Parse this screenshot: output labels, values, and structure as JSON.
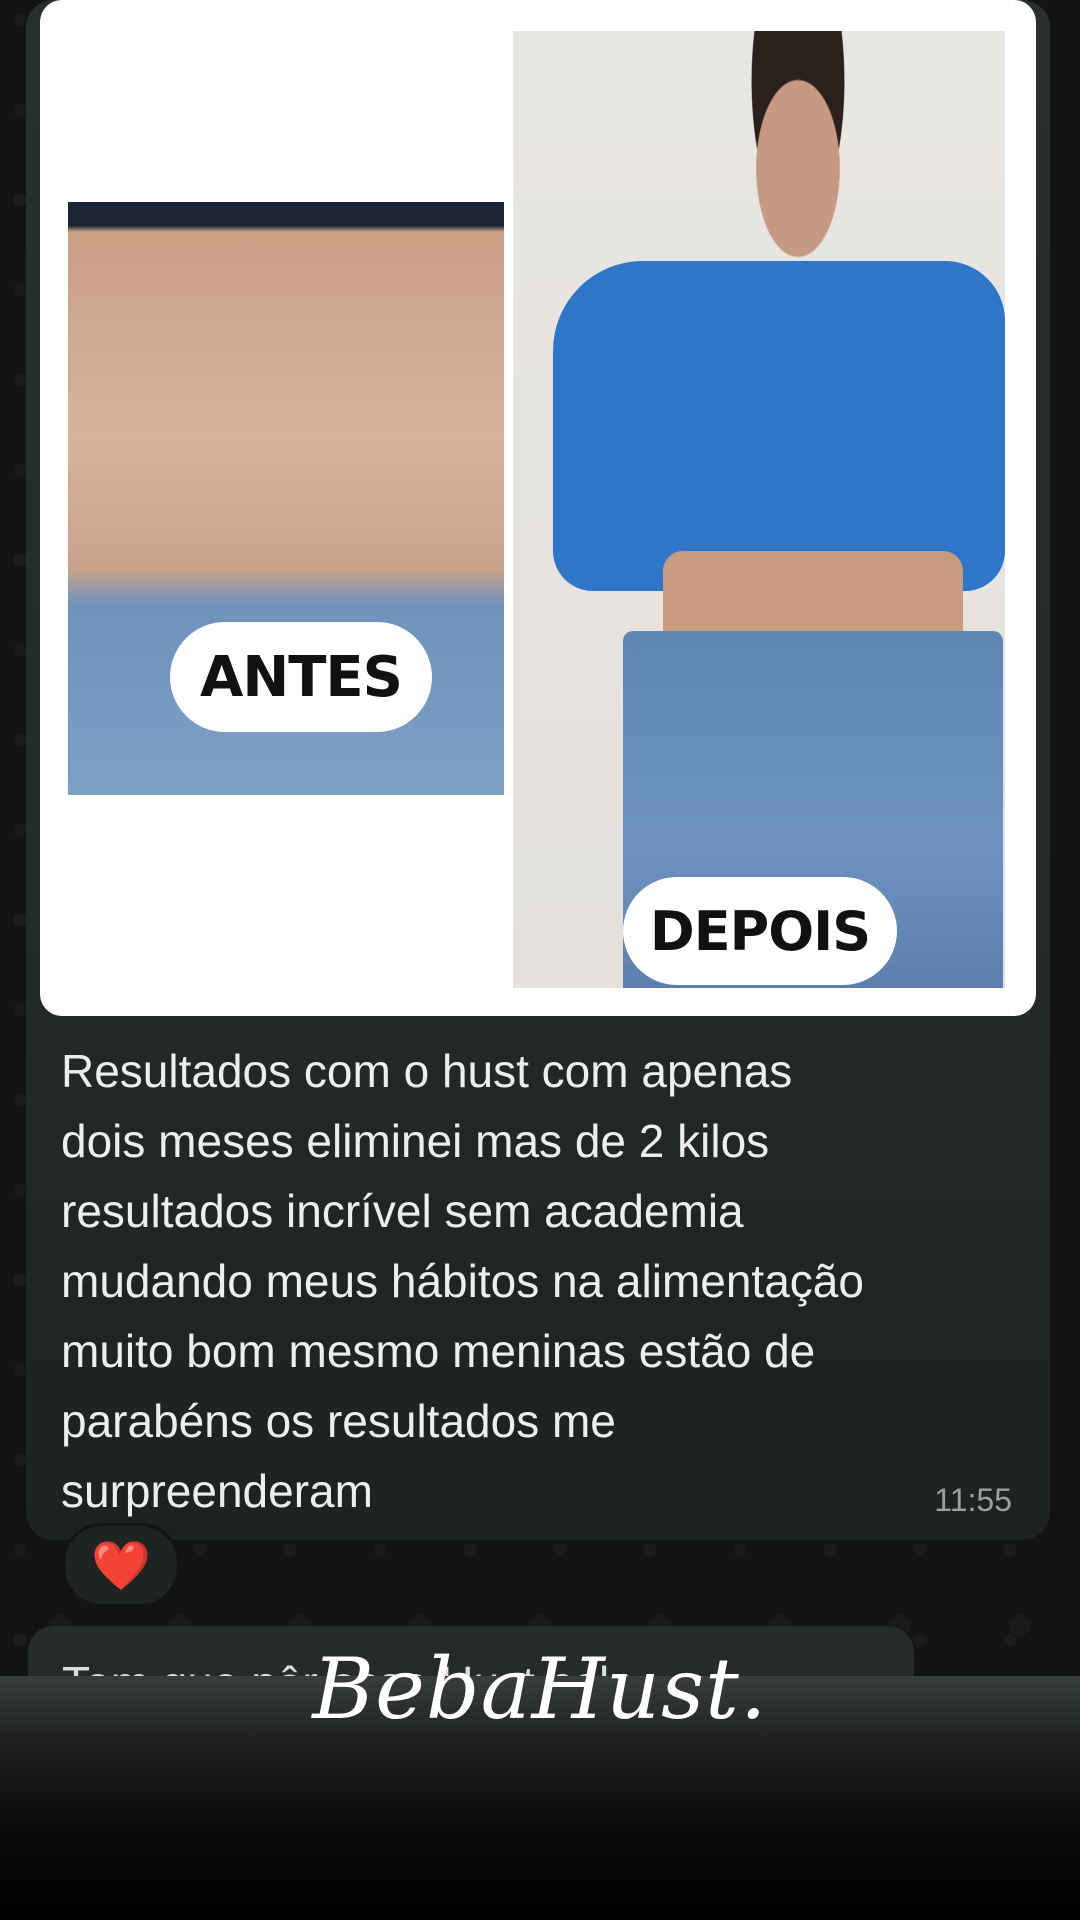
{
  "media": {
    "before_label": "ANTES",
    "after_label": "DEPOIS"
  },
  "message": {
    "text_lines": [
      "Resultados com o hust com apenas",
      "dois meses eliminei mas de 2 kilos",
      "resultados incrível sem academia",
      "mudando meus hábitos na alimentação",
      "muito bom mesmo meninas estão de",
      "parabéns os resultados me",
      "surpreenderam"
    ],
    "time": "11:55",
    "reaction": "❤️"
  },
  "next_message": {
    "partial_text": "Tem que pôr esse Hust pela"
  },
  "caption": {
    "text": "BebaHust."
  },
  "colors": {
    "background": "#111413",
    "bubble": "#262a29",
    "shirt": "#2f76c8"
  }
}
